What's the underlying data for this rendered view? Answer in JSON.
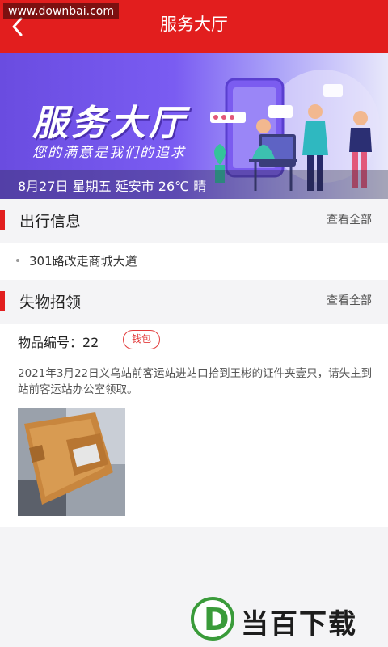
{
  "watermark": "www.downbai.com",
  "header": {
    "title": "服务大厅"
  },
  "banner": {
    "title": "服务大厅",
    "subtitle": "您的满意是我们的追求",
    "info": "8月27日  星期五  延安市 26℃ 晴"
  },
  "travel": {
    "title": "出行信息",
    "more": "查看全部",
    "items": [
      "301路改走商城大道"
    ]
  },
  "lost": {
    "title": "失物招领",
    "more": "查看全部",
    "item_no": "物品编号：22",
    "tag": "钱包",
    "description": "2021年3月22日义乌站前客运站进站口拾到王彬的证件夹壹只，请失主到站前客运站办公室领取。"
  },
  "footer": {
    "brand": "当百下载",
    "mark": "D"
  },
  "colors": {
    "accent": "#e21e1e",
    "banner": "#7a5cf2",
    "brand_green": "#3a9b3a"
  },
  "icons": {
    "back": "chevron-left-icon"
  }
}
